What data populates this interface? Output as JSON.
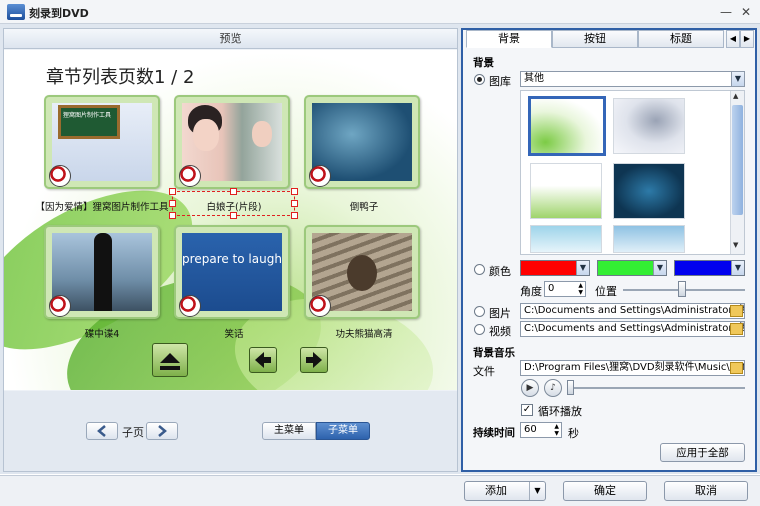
{
  "window": {
    "title": "刻录到DVD",
    "minimize": "—",
    "close": "✕"
  },
  "preview": {
    "header": "预览",
    "heading": "章节列表页数1 / 2",
    "chapters": [
      {
        "label": "【因为爱情】狸窝图片制作工具",
        "inner_text": "狸窝图片制作工具"
      },
      {
        "label": "白娘子(片段)"
      },
      {
        "label": "倒鸭子"
      },
      {
        "label": "碟中谍4"
      },
      {
        "label": "笑话",
        "inner_text": "prepare to laugh"
      },
      {
        "label": "功夫熊猫高清"
      }
    ]
  },
  "left_bottom": {
    "subpage_label": "子页",
    "main_menu": "主菜单",
    "sub_menu": "子菜单"
  },
  "right": {
    "tabs": [
      "背景",
      "按钮",
      "标题"
    ],
    "background_title": "背景",
    "library_label": "图库",
    "library_value": "其他",
    "color_label": "颜色",
    "angle_label": "角度",
    "angle_value": "0",
    "position_label": "位置",
    "colors": [
      "#ff0000",
      "#33ee33",
      "#0000ee"
    ],
    "picture_label": "图片",
    "picture_path": "C:\\Documents and Settings\\Administrator\\桌面",
    "video_label": "视频",
    "video_path": "C:\\Documents and Settings\\Administrator\\桌面",
    "music_title": "背景音乐",
    "file_label": "文件",
    "file_path": "D:\\Program Files\\狸窝\\DVD刻录软件\\Music\\defa",
    "loop_label": "循环播放",
    "duration_label": "持续时间",
    "duration_value": "60",
    "duration_unit": "秒",
    "apply_all": "应用于全部"
  },
  "footer": {
    "add": "添加",
    "ok": "确定",
    "cancel": "取消"
  }
}
